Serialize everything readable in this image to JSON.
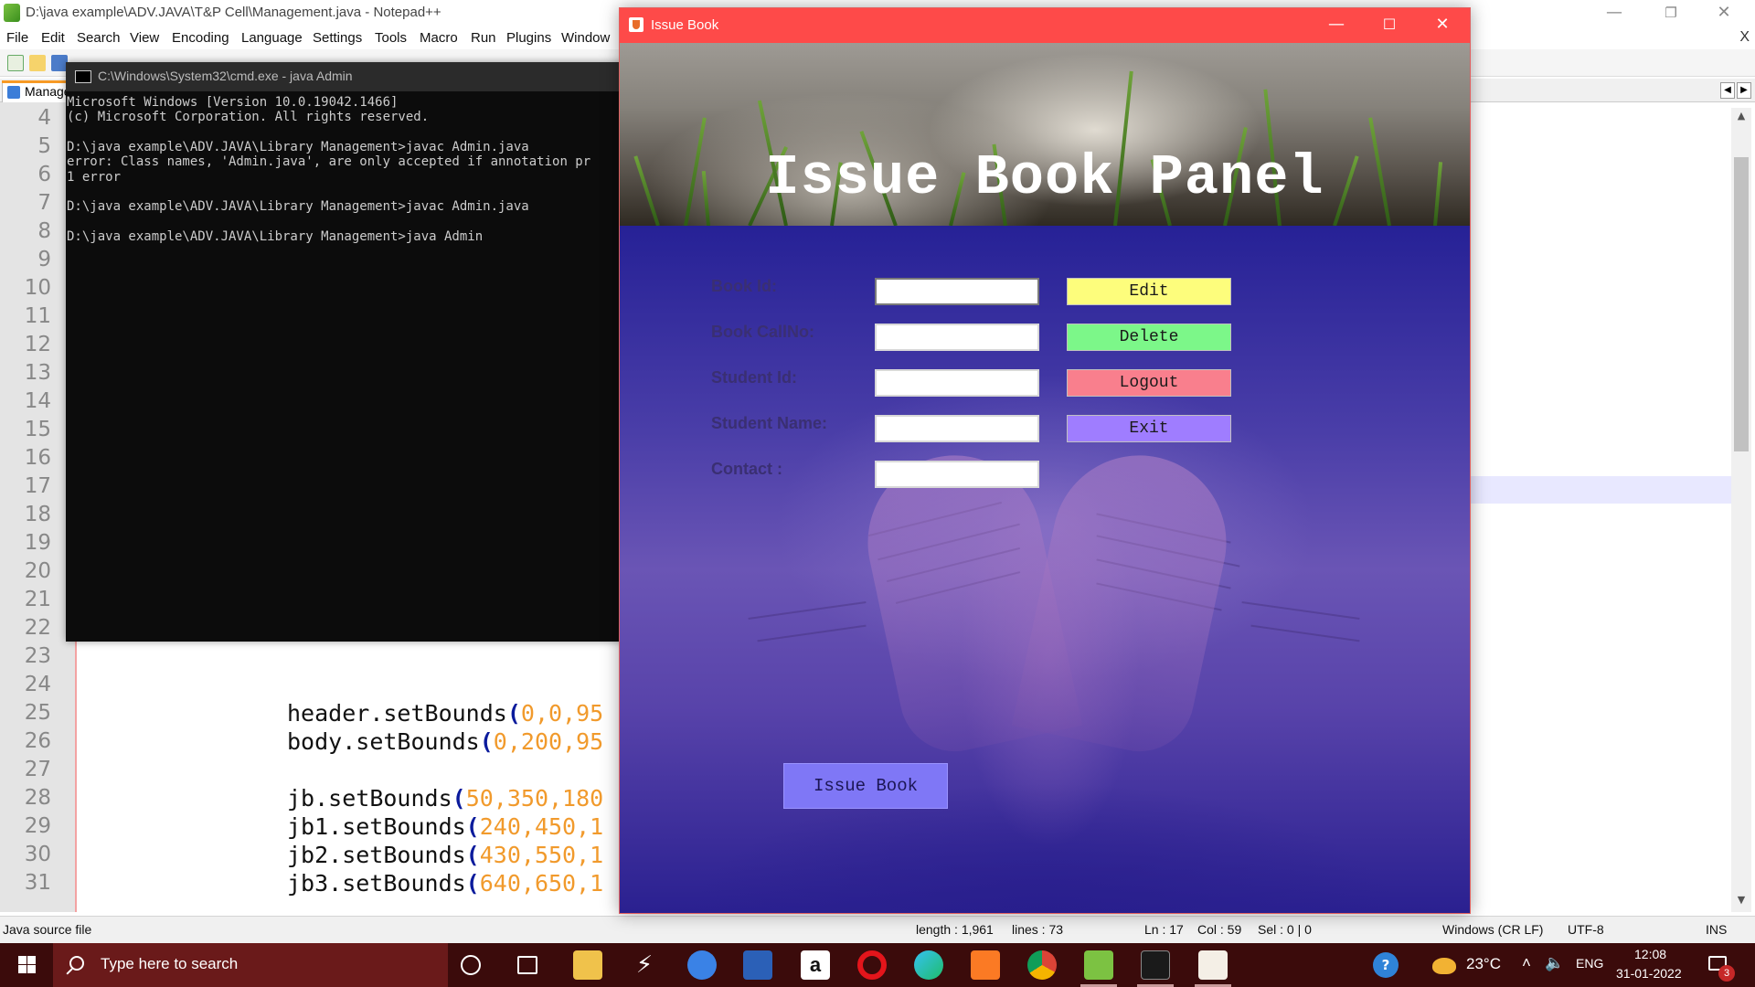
{
  "notepad": {
    "title": "D:\\java example\\ADV.JAVA\\T&P Cell\\Management.java - Notepad++",
    "menu": [
      "File",
      "Edit",
      "Search",
      "View",
      "Encoding",
      "Language",
      "Settings",
      "Tools",
      "Macro",
      "Run",
      "Plugins",
      "Window"
    ],
    "close_x": "X",
    "tab_label": "Manage",
    "line_numbers": [
      "4",
      "5",
      "6",
      "7",
      "8",
      "9",
      "10",
      "11",
      "12",
      "13",
      "14",
      "15",
      "16",
      "17",
      "18",
      "19",
      "20",
      "21",
      "22",
      "23",
      "24",
      "25",
      "26",
      "27",
      "28",
      "29",
      "30",
      "31"
    ],
    "code": {
      "l25_obj": "header",
      "l25_method": ".setBounds",
      "l25_args": "0,0,95",
      "l26_obj": "body",
      "l26_method": ".setBounds",
      "l26_args": "0,200,95",
      "l28_obj": "jb",
      "l28_method": ".setBounds",
      "l28_args": "50,350,180",
      "l29_obj": "jb1",
      "l29_method": ".setBounds",
      "l29_args": "240,450,1",
      "l30_obj": "jb2",
      "l30_method": ".setBounds",
      "l30_args": "430,550,1",
      "l31_obj": "jb3",
      "l31_method": ".setBounds",
      "l31_args": "640,650,1",
      "paren": "("
    },
    "status": {
      "file_type": "Java source file",
      "length": "length : 1,961",
      "lines": "lines : 73",
      "ln": "Ln : 17",
      "col": "Col : 59",
      "sel": "Sel : 0 | 0",
      "eol": "Windows (CR LF)",
      "encoding": "UTF-8",
      "mode": "INS"
    }
  },
  "cmd": {
    "title": "C:\\Windows\\System32\\cmd.exe - java  Admin",
    "lines": [
      "Microsoft Windows [Version 10.0.19042.1466]",
      "(c) Microsoft Corporation. All rights reserved.",
      "",
      "D:\\java example\\ADV.JAVA\\Library Management>javac Admin.java",
      "error: Class names, 'Admin.java', are only accepted if annotation pr",
      "1 error",
      "",
      "D:\\java example\\ADV.JAVA\\Library Management>javac Admin.java",
      "",
      "D:\\java example\\ADV.JAVA\\Library Management>java Admin"
    ]
  },
  "issue_window": {
    "title": "Issue Book",
    "header_title": "Issue Book Panel",
    "fields": [
      {
        "label": "Book Id:",
        "value": ""
      },
      {
        "label": "Book CallNo:",
        "value": ""
      },
      {
        "label": "Student Id:",
        "value": ""
      },
      {
        "label": "Student Name:",
        "value": ""
      },
      {
        "label": "Contact :",
        "value": ""
      }
    ],
    "buttons": [
      {
        "label": "Edit",
        "color": "#fdfd7c"
      },
      {
        "label": "Delete",
        "color": "#7cf789"
      },
      {
        "label": "Logout",
        "color": "#f97f8d"
      },
      {
        "label": "Exit",
        "color": "#9f7dff"
      }
    ],
    "issue_button": "Issue Book"
  },
  "taskbar": {
    "search_placeholder": "Type here to search",
    "temperature": "23°C",
    "language": "ENG",
    "time": "12:08",
    "date": "31-01-2022",
    "notifications": "3"
  }
}
